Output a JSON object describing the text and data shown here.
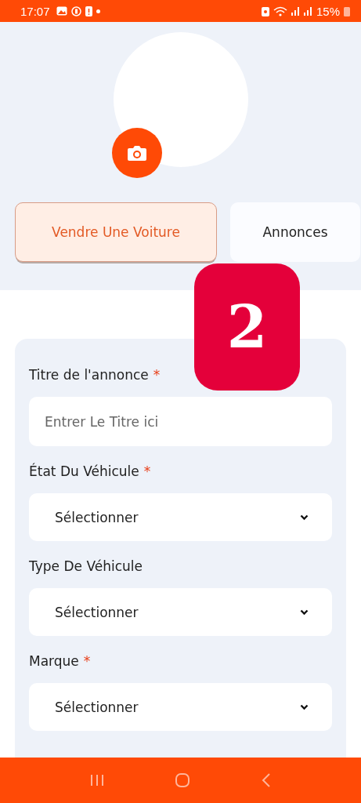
{
  "status_bar": {
    "time": "17:07",
    "battery": "15%"
  },
  "tabs": [
    {
      "label": "Vendre Une Voiture",
      "selected": true
    },
    {
      "label": "Annonces",
      "selected": false
    }
  ],
  "step_badge": "2",
  "form": {
    "fields": [
      {
        "kind": "text",
        "label": "Titre de l'annonce",
        "marker": "*",
        "placeholder": "Entrer Le Titre ici"
      },
      {
        "kind": "select",
        "label": "État Du Véhicule",
        "marker": "*",
        "value": "Sélectionner"
      },
      {
        "kind": "select",
        "label": "Type De Véhicule",
        "value": "Sélectionner"
      },
      {
        "kind": "select",
        "label": "Marque",
        "marker": "*",
        "value": "Sélectionner"
      }
    ]
  }
}
